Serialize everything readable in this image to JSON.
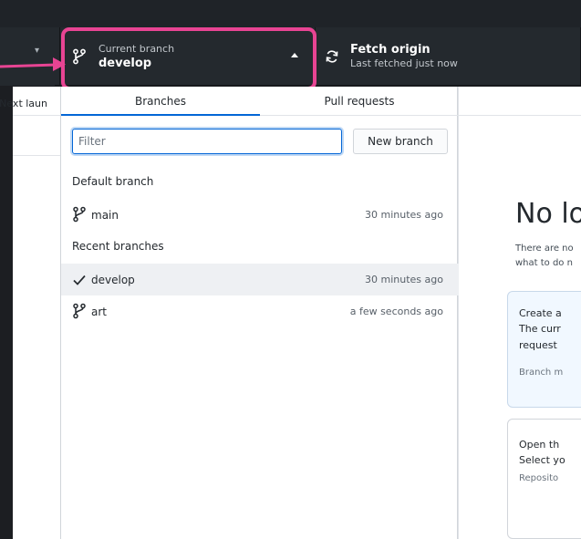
{
  "toolbar": {
    "current_branch": {
      "caption": "Current branch",
      "name": "develop"
    },
    "fetch": {
      "title": "Fetch origin",
      "subtitle": "Last fetched just now"
    }
  },
  "left_pane": {
    "truncated_text": "Next laun"
  },
  "dropdown": {
    "tabs": [
      {
        "label": "Branches",
        "active": true
      },
      {
        "label": "Pull requests",
        "active": false
      }
    ],
    "filter": {
      "placeholder": "Filter"
    },
    "new_branch_label": "New branch",
    "sections": {
      "default": {
        "title": "Default branch",
        "branches": [
          {
            "name": "main",
            "time": "30 minutes ago",
            "icon": "git-branch-icon"
          }
        ]
      },
      "recent": {
        "title": "Recent branches",
        "branches": [
          {
            "name": "develop",
            "time": "30 minutes ago",
            "icon": "check-icon",
            "selected": true
          },
          {
            "name": "art",
            "time": "a few seconds ago",
            "icon": "git-branch-icon"
          }
        ]
      }
    }
  },
  "right_pane": {
    "heading": "No lo",
    "desc_line1": "There are no",
    "desc_line2": "what to do n",
    "card_a": {
      "title": "Create a",
      "line1": "The curr",
      "line2": "request ",
      "meta": "Branch m"
    },
    "card_b": {
      "title": "Open th",
      "line1": "Select yo",
      "meta": "Reposito"
    }
  },
  "colors": {
    "toolbar_bg": "#24292e",
    "highlight": "#e84493",
    "accent": "#0366d6",
    "selected_row": "#eef0f3"
  }
}
